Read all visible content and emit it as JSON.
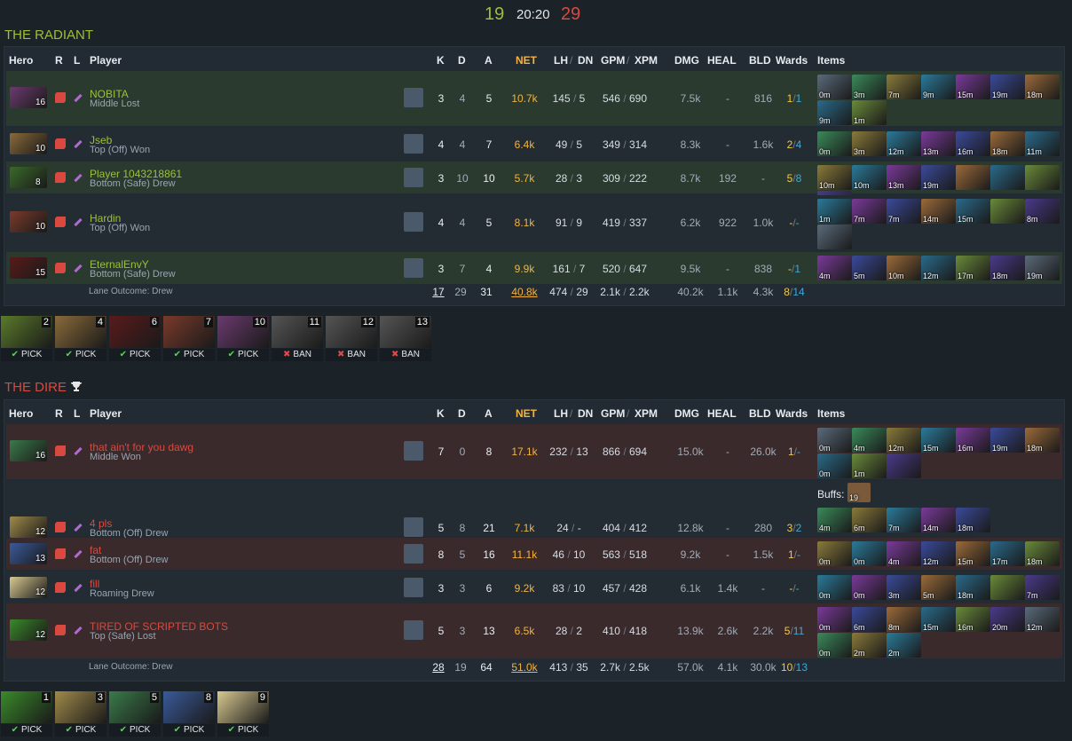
{
  "score": {
    "radiant": "19",
    "clock": "20:20",
    "dire": "29"
  },
  "radiant": {
    "title": "THE RADIANT",
    "headers": {
      "hero": "Hero",
      "r": "R",
      "l": "L",
      "player": "Player",
      "k": "K",
      "d": "D",
      "a": "A",
      "net": "NET",
      "lh": "LH",
      "dn": "DN",
      "gpm": "GPM",
      "xpm": "XPM",
      "dmg": "DMG",
      "heal": "HEAL",
      "bld": "BLD",
      "wards": "Wards",
      "items": "Items"
    },
    "players": [
      {
        "name": "NOBITA",
        "lane": "Middle Lost",
        "level": "16",
        "k": "3",
        "d": "4",
        "a": "5",
        "net": "10.7k",
        "lh": "145",
        "dn": "5",
        "gpm": "546",
        "xpm": "690",
        "dmg": "7.5k",
        "heal": "-",
        "bld": "816",
        "w_obs": "1",
        "w_sen": "1",
        "items": [
          "0m",
          "3m",
          "7m",
          "9m",
          "15m",
          "19m",
          "18m",
          "9m",
          "1m"
        ]
      },
      {
        "name": "Jseb",
        "lane": "Top (Off) Won",
        "level": "10",
        "k": "4",
        "d": "4",
        "a": "7",
        "net": "6.4k",
        "lh": "49",
        "dn": "5",
        "gpm": "349",
        "xpm": "314",
        "dmg": "8.3k",
        "heal": "-",
        "bld": "1.6k",
        "w_obs": "2",
        "w_sen": "4",
        "items": [
          "0m",
          "3m",
          "12m",
          "13m",
          "16m",
          "18m",
          "11m"
        ]
      },
      {
        "name": "Player 1043218861",
        "lane": "Bottom (Safe) Drew",
        "level": "8",
        "k": "3",
        "d": "10",
        "a": "10",
        "net": "5.7k",
        "lh": "28",
        "dn": "3",
        "gpm": "309",
        "xpm": "222",
        "dmg": "8.7k",
        "heal": "192",
        "bld": "-",
        "w_obs": "5",
        "w_sen": "8",
        "items": [
          "10m",
          "10m",
          "13m",
          "19m",
          "",
          "",
          "",
          "9m"
        ]
      },
      {
        "name": "Hardin",
        "lane": "Top (Off) Won",
        "level": "10",
        "k": "4",
        "d": "4",
        "a": "5",
        "net": "8.1k",
        "lh": "91",
        "dn": "9",
        "gpm": "419",
        "xpm": "337",
        "dmg": "6.2k",
        "heal": "922",
        "bld": "1.0k",
        "w_obs": "-",
        "w_sen": "-",
        "items": [
          "1m",
          "7m",
          "7m",
          "14m",
          "15m",
          "",
          "8m",
          ""
        ]
      },
      {
        "name": "EternalEnvY",
        "lane": "Bottom (Safe) Drew",
        "level": "15",
        "k": "3",
        "d": "7",
        "a": "4",
        "net": "9.9k",
        "lh": "161",
        "dn": "7",
        "gpm": "520",
        "xpm": "647",
        "dmg": "9.5k",
        "heal": "-",
        "bld": "838",
        "w_obs": "-",
        "w_sen": "1",
        "items": [
          "4m",
          "5m",
          "10m",
          "12m",
          "17m",
          "18m",
          "19m"
        ]
      }
    ],
    "totals": {
      "lane_outcome": "Lane Outcome: Drew",
      "k": "17",
      "d": "29",
      "a": "31",
      "net": "40.8k",
      "lh": "474",
      "dn": "29",
      "gpm": "2.1k",
      "xpm": "2.2k",
      "dmg": "40.2k",
      "heal": "1.1k",
      "bld": "4.3k",
      "w_obs": "8",
      "w_sen": "14"
    },
    "picks": [
      {
        "order": "2",
        "label": "PICK"
      },
      {
        "order": "4",
        "label": "PICK"
      },
      {
        "order": "6",
        "label": "PICK"
      },
      {
        "order": "7",
        "label": "PICK"
      },
      {
        "order": "10",
        "label": "PICK"
      },
      {
        "order": "11",
        "label": "BAN"
      },
      {
        "order": "12",
        "label": "BAN"
      },
      {
        "order": "13",
        "label": "BAN"
      }
    ]
  },
  "dire": {
    "title": "THE DIRE",
    "headers": {
      "hero": "Hero",
      "r": "R",
      "l": "L",
      "player": "Player",
      "k": "K",
      "d": "D",
      "a": "A",
      "net": "NET",
      "lh": "LH",
      "dn": "DN",
      "gpm": "GPM",
      "xpm": "XPM",
      "dmg": "DMG",
      "heal": "HEAL",
      "bld": "BLD",
      "wards": "Wards",
      "items": "Items"
    },
    "buffs_label": "Buffs:",
    "buff_count": "19",
    "players": [
      {
        "name": "that ain't for you dawg",
        "lane": "Middle Won",
        "level": "16",
        "k": "7",
        "d": "0",
        "a": "8",
        "net": "17.1k",
        "lh": "232",
        "dn": "13",
        "gpm": "866",
        "xpm": "694",
        "dmg": "15.0k",
        "heal": "-",
        "bld": "26.0k",
        "w_obs": "1",
        "w_sen": "-",
        "items": [
          "0m",
          "4m",
          "12m",
          "15m",
          "16m",
          "19m",
          "18m",
          "0m",
          "1m",
          ""
        ]
      },
      {
        "name": "4 pls",
        "lane": "Bottom (Off) Drew",
        "level": "12",
        "k": "5",
        "d": "8",
        "a": "21",
        "net": "7.1k",
        "lh": "24",
        "dn": "-",
        "gpm": "404",
        "xpm": "412",
        "dmg": "12.8k",
        "heal": "-",
        "bld": "280",
        "w_obs": "3",
        "w_sen": "2",
        "items": [
          "4m",
          "6m",
          "7m",
          "14m",
          "18m"
        ]
      },
      {
        "name": "fat",
        "lane": "Bottom (Off) Drew",
        "level": "13",
        "k": "8",
        "d": "5",
        "a": "16",
        "net": "11.1k",
        "lh": "46",
        "dn": "10",
        "gpm": "563",
        "xpm": "518",
        "dmg": "9.2k",
        "heal": "-",
        "bld": "1.5k",
        "w_obs": "1",
        "w_sen": "-",
        "items": [
          "0m",
          "0m",
          "4m",
          "12m",
          "15m",
          "17m",
          "18m"
        ]
      },
      {
        "name": "fill",
        "lane": "Roaming Drew",
        "level": "12",
        "k": "3",
        "d": "3",
        "a": "6",
        "net": "9.2k",
        "lh": "83",
        "dn": "10",
        "gpm": "457",
        "xpm": "428",
        "dmg": "6.1k",
        "heal": "1.4k",
        "bld": "-",
        "w_obs": "-",
        "w_sen": "-",
        "items": [
          "0m",
          "0m",
          "3m",
          "5m",
          "18m",
          "",
          "7m"
        ]
      },
      {
        "name": "TIRED OF SCRIPTED BOTS",
        "lane": "Top (Safe) Lost",
        "level": "12",
        "k": "5",
        "d": "3",
        "a": "13",
        "net": "6.5k",
        "lh": "28",
        "dn": "2",
        "gpm": "410",
        "xpm": "418",
        "dmg": "13.9k",
        "heal": "2.6k",
        "bld": "2.2k",
        "w_obs": "5",
        "w_sen": "11",
        "items": [
          "0m",
          "6m",
          "8m",
          "15m",
          "16m",
          "20m",
          "12m",
          "0m",
          "2m",
          "2m"
        ]
      }
    ],
    "totals": {
      "lane_outcome": "Lane Outcome: Drew",
      "k": "28",
      "d": "19",
      "a": "64",
      "net": "51.0k",
      "lh": "413",
      "dn": "35",
      "gpm": "2.7k",
      "xpm": "2.5k",
      "dmg": "57.0k",
      "heal": "4.1k",
      "bld": "30.0k",
      "w_obs": "10",
      "w_sen": "13"
    },
    "picks": [
      {
        "order": "1",
        "label": "PICK"
      },
      {
        "order": "3",
        "label": "PICK"
      },
      {
        "order": "5",
        "label": "PICK"
      },
      {
        "order": "8",
        "label": "PICK"
      },
      {
        "order": "9",
        "label": "PICK"
      }
    ]
  },
  "colors": {
    "radiant": "#9fbe3c",
    "dire": "#d9493f",
    "gold": "#f5b33e",
    "ward_obs": "#f5c842",
    "ward_sen": "#3fa9d6"
  }
}
